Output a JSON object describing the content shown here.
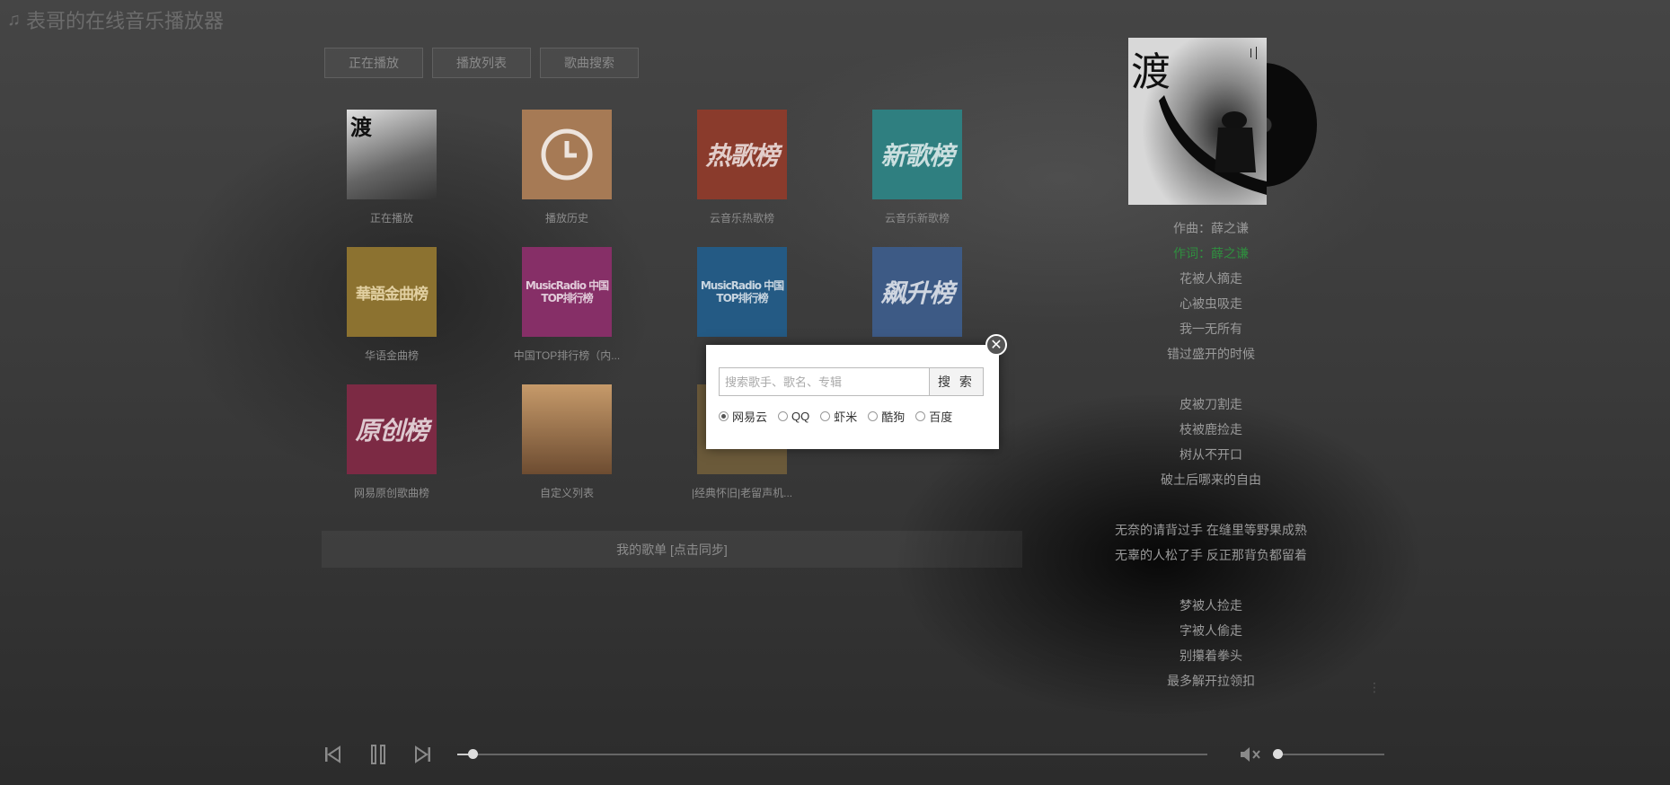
{
  "app": {
    "title": "表哥的在线音乐播放器",
    "title_icon": "music-note-icon"
  },
  "tabs": [
    {
      "label": "正在播放"
    },
    {
      "label": "播放列表"
    },
    {
      "label": "歌曲搜索"
    }
  ],
  "playlists": [
    {
      "label": "正在播放",
      "cover_text": "渡",
      "color": "#5a5a5a"
    },
    {
      "label": "播放历史",
      "cover_text": "",
      "color": "#a67a55"
    },
    {
      "label": "云音乐热歌榜",
      "cover_text": "热歌榜",
      "color": "#8a3b2c"
    },
    {
      "label": "云音乐新歌榜",
      "cover_text": "新歌榜",
      "color": "#2f7f80"
    },
    {
      "label": "华语金曲榜",
      "cover_text": "華語金曲榜",
      "color": "#8c7230"
    },
    {
      "label": "中国TOP排行榜（内...",
      "cover_text": "MusicRadio 中国TOP排行榜",
      "color": "#862f67"
    },
    {
      "label": "",
      "cover_text": "MusicRadio 中国TOP排行榜",
      "color": "#245a84"
    },
    {
      "label": "",
      "cover_text": "飙升榜",
      "color": "#3d5a85"
    },
    {
      "label": "网易原创歌曲榜",
      "cover_text": "原创榜",
      "color": "#7c2a44"
    },
    {
      "label": "自定义列表",
      "cover_text": "",
      "color": "#7a5a3a"
    },
    {
      "label": "|经典怀旧|老留声机...",
      "cover_text": "",
      "color": "#6b5a3a"
    }
  ],
  "sync": {
    "label": "我的歌单 [点击同步]"
  },
  "now_playing": {
    "cover_text": "渡"
  },
  "lyrics": [
    "作曲：薛之谦",
    "作词：薛之谦",
    "花被人摘走",
    "心被虫吸走",
    "我一无所有",
    "错过盛开的时候",
    "",
    "皮被刀割走",
    "枝被鹿捡走",
    "树从不开口",
    "破土后哪来的自由",
    "",
    "无奈的请背过手 在缝里等野果成熟",
    "无辜的人松了手 反正那背负都留着",
    "",
    "梦被人捡走",
    "字被人偷走",
    "别攥着拳头",
    "最多解开拉领扣"
  ],
  "lyrics_highlight_index": 1,
  "player": {
    "progress": 0.02,
    "volume": 0.0,
    "muted": true,
    "icons": [
      "prev-icon",
      "pause-icon",
      "next-icon",
      "mute-icon"
    ]
  },
  "search": {
    "placeholder": "搜索歌手、歌名、专辑",
    "button": "搜 索",
    "sources": [
      "网易云",
      "QQ",
      "虾米",
      "酷狗",
      "百度"
    ],
    "selected": 0
  },
  "colors": {
    "highlight": "#2f8f3f",
    "modal_bg": "#ffffff"
  }
}
